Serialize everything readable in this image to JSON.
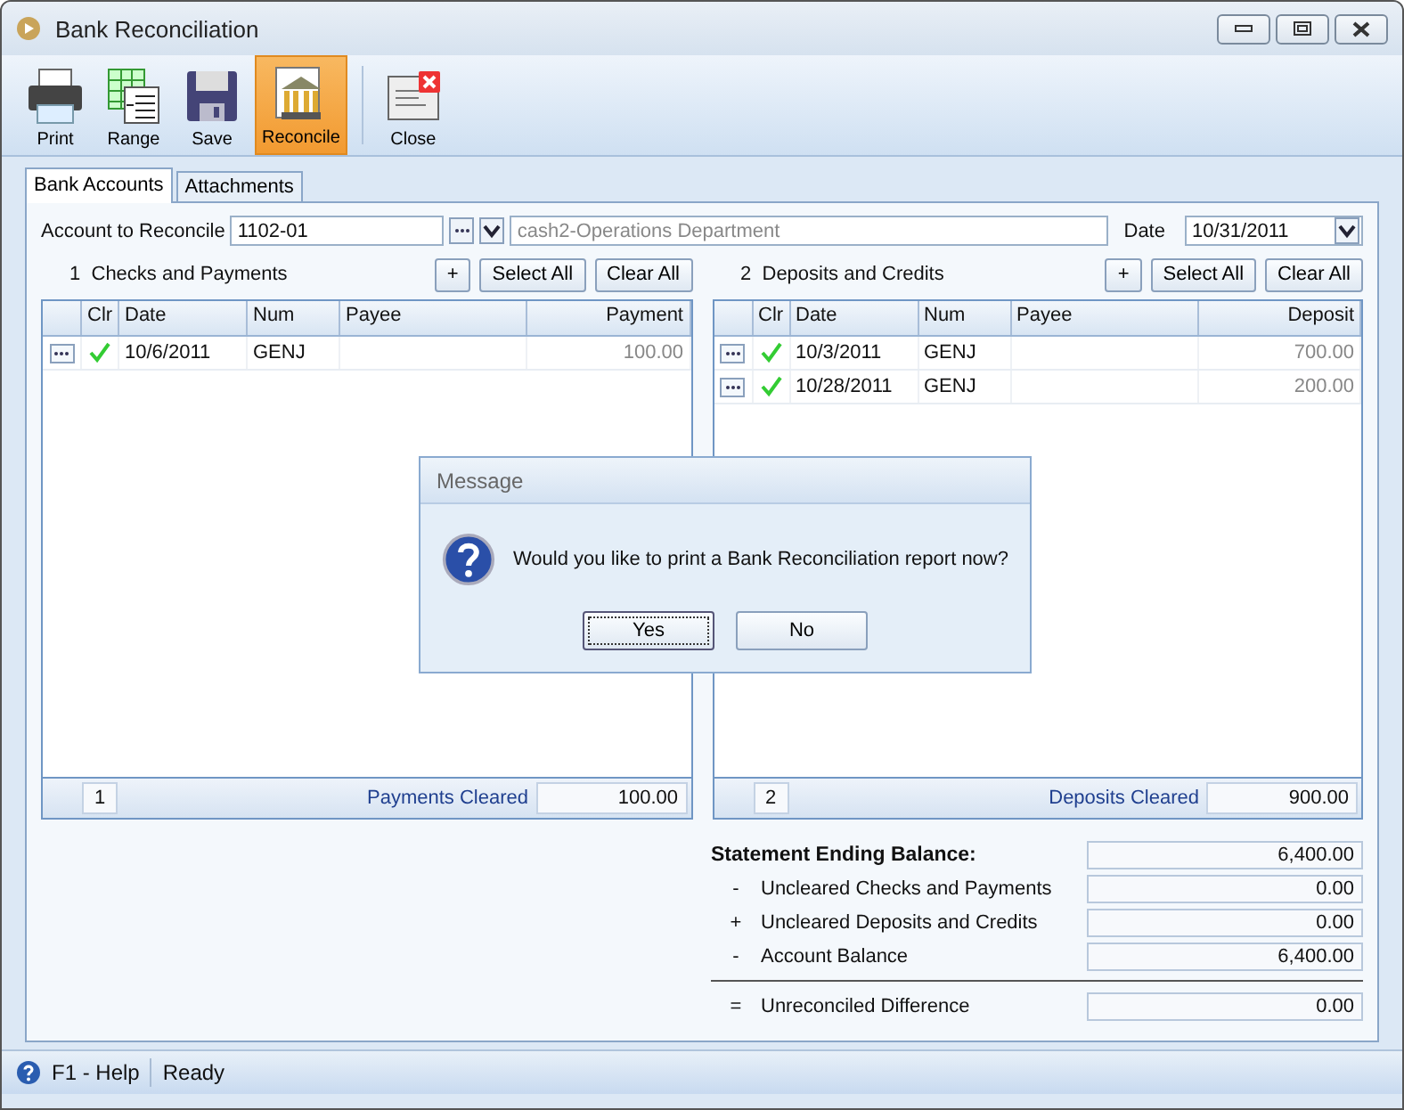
{
  "window": {
    "title": "Bank Reconciliation"
  },
  "toolbar": [
    {
      "label": "Print",
      "kind": "print",
      "selected": false
    },
    {
      "label": "Range",
      "kind": "range",
      "selected": false
    },
    {
      "label": "Save",
      "kind": "save",
      "selected": false
    },
    {
      "label": "Reconcile",
      "kind": "reconcile",
      "selected": true
    },
    {
      "label": "Close",
      "kind": "close",
      "selected": false
    }
  ],
  "tabs": [
    {
      "label": "Bank Accounts",
      "selected": true
    },
    {
      "label": "Attachments",
      "selected": false
    }
  ],
  "account": {
    "label": "Account to Reconcile",
    "value": "1102-01",
    "description": "cash2-Operations Department"
  },
  "date": {
    "label": "Date",
    "value": "10/31/2011"
  },
  "panels": [
    {
      "count": "1",
      "title": "Checks and Payments",
      "add": "+",
      "select_all": "Select All",
      "clear_all": "Clear All",
      "columns": [
        "Clr",
        "Date",
        "Num",
        "Payee",
        "Payment"
      ],
      "rows": [
        {
          "cleared": true,
          "date": "10/6/2011",
          "num": "GENJ",
          "amount": "100.00"
        }
      ],
      "footer_count": "1",
      "footer_label": "Payments Cleared",
      "footer_total": "100.00"
    },
    {
      "count": "2",
      "title": "Deposits and Credits",
      "add": "+",
      "select_all": "Select All",
      "clear_all": "Clear All",
      "columns": [
        "Clr",
        "Date",
        "Num",
        "Payee",
        "Deposit"
      ],
      "rows": [
        {
          "cleared": true,
          "date": "10/3/2011",
          "num": "GENJ",
          "amount": "700.00"
        },
        {
          "cleared": true,
          "date": "10/28/2011",
          "num": "GENJ",
          "amount": "200.00"
        }
      ],
      "footer_count": "2",
      "footer_label": "Deposits Cleared",
      "footer_total": "900.00"
    }
  ],
  "summary": [
    {
      "kind": "heading",
      "label": "Statement Ending Balance:",
      "value": "6,400.00"
    },
    {
      "kind": "line",
      "sign": "-",
      "label": "Uncleared Checks and Payments",
      "value": "0.00"
    },
    {
      "kind": "line",
      "sign": "+",
      "label": "Uncleared Deposits and Credits",
      "value": "0.00"
    },
    {
      "kind": "line",
      "sign": "-",
      "label": "Account Balance",
      "value": "6,400.00"
    },
    {
      "kind": "total",
      "sign": "=",
      "label": "Unreconciled Difference",
      "value": "0.00"
    }
  ],
  "dialog": {
    "title": "Message",
    "text": "Would you like to print a Bank Reconciliation report now?",
    "buttons": [
      {
        "label": "Yes",
        "selected": true
      },
      {
        "label": "No",
        "selected": false
      }
    ]
  },
  "status_bar": {
    "help": "F1 - Help",
    "status": "Ready"
  }
}
